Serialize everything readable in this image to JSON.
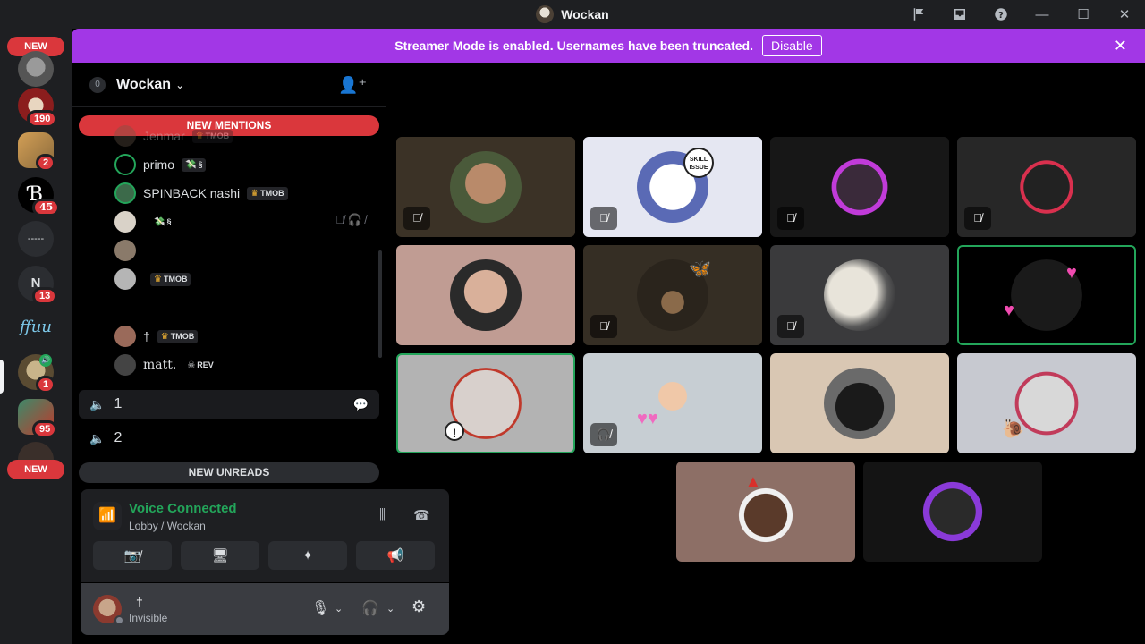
{
  "window": {
    "title": "Wockan"
  },
  "titlebar_icons": [
    "flag-icon",
    "inbox-icon",
    "help-icon",
    "minimize-icon",
    "maximize-icon",
    "close-icon"
  ],
  "rail": {
    "new_top": "NEW",
    "new_bottom": "NEW",
    "servers": [
      {
        "name": "server-1",
        "badge": ""
      },
      {
        "name": "server-2",
        "badge": "190"
      },
      {
        "name": "server-3",
        "badge": "2"
      },
      {
        "name": "server-4",
        "badge": "45",
        "label": "Ɓ"
      },
      {
        "name": "server-5",
        "badge": "",
        "label": "-----"
      },
      {
        "name": "server-6",
        "badge": "13",
        "label": "N"
      },
      {
        "name": "server-7",
        "badge": "",
        "label": "ffuu"
      },
      {
        "name": "server-8",
        "badge": "1"
      },
      {
        "name": "server-9",
        "badge": "95"
      }
    ]
  },
  "banner": {
    "text": "Streamer Mode is enabled. Usernames have been truncated.",
    "button": "Disable"
  },
  "guild": {
    "boost_level": "0",
    "name": "Wockan"
  },
  "sidebar": {
    "new_mentions": "NEW MENTIONS",
    "new_unreads": "NEW UNREADS",
    "voice_users": [
      {
        "name": "Jenmar",
        "tag": "TMOB"
      },
      {
        "name": "primo",
        "tag": "§"
      },
      {
        "name": "SPINBACK nashi",
        "tag": "TMOB"
      },
      {
        "name": "",
        "tag": "§"
      },
      {
        "name": "",
        "tag": ""
      },
      {
        "name": "",
        "tag": "TMOB"
      },
      {
        "name": "†",
        "tag": "TMOB"
      },
      {
        "name": "matt.",
        "tag": "REV"
      }
    ],
    "voice_channels": [
      {
        "name": "1"
      },
      {
        "name": "2"
      }
    ]
  },
  "voice": {
    "status": "Voice Connected",
    "channel": "Lobby / Wockan"
  },
  "user": {
    "name": "†",
    "status": "Invisible"
  },
  "colors": {
    "banner": "#a237e6",
    "mention": "#da373c",
    "connected": "#23a55a",
    "background": "#000000"
  }
}
